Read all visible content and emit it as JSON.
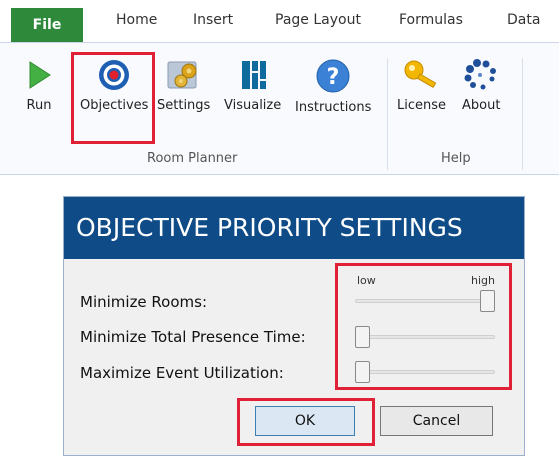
{
  "ribbon": {
    "tabs": [
      "File",
      "Home",
      "Insert",
      "Page Layout",
      "Formulas",
      "Data"
    ],
    "buttons": [
      "Run",
      "Objectives",
      "Settings",
      "Visualize",
      "Instructions",
      "License",
      "About"
    ],
    "groups": [
      "Room Planner",
      "Help"
    ],
    "icons": [
      "play-icon",
      "target-icon",
      "gears-icon",
      "visualize-icon",
      "help-icon",
      "key-icon",
      "dots-icon"
    ]
  },
  "dialog": {
    "title": "OBJECTIVE PRIORITY SETTINGS",
    "low": "low",
    "high": "high",
    "rows": [
      {
        "label": "Minimize Rooms:",
        "level": 1
      },
      {
        "label": "Minimize Total Presence Time:",
        "level": 0
      },
      {
        "label": "Maximize Event Utilization:",
        "level": 0
      }
    ],
    "ok": "OK",
    "cancel": "Cancel"
  },
  "colors": {
    "file_tab": "#2e8a3a",
    "dialog_title_bg": "#0f4b86",
    "highlight": "#e02035"
  }
}
